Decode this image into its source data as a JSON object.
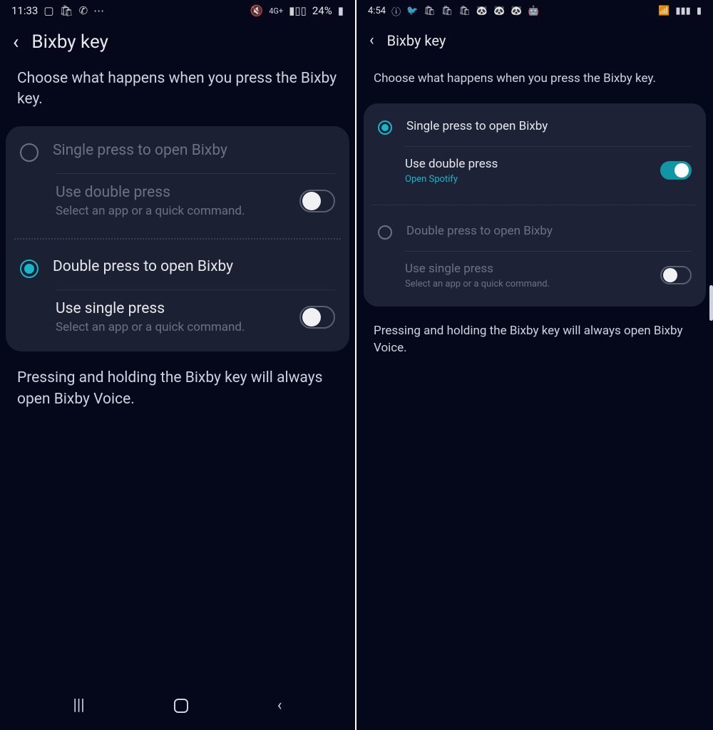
{
  "left": {
    "status": {
      "time": "11:33",
      "battery": "24%",
      "net": "4G+"
    },
    "title": "Bixby key",
    "lead": "Choose what happens when you press the Bixby key.",
    "opt1": {
      "label": "Single press to open Bixby",
      "selected": false
    },
    "sub1": {
      "label": "Use double press",
      "desc": "Select an app or a quick command.",
      "on": false,
      "enabled": false
    },
    "opt2": {
      "label": "Double press to open Bixby",
      "selected": true
    },
    "sub2": {
      "label": "Use single press",
      "desc": "Select an app or a quick command.",
      "on": false,
      "enabled": true
    },
    "foot": "Pressing and holding the Bixby key will always open Bixby Voice."
  },
  "right": {
    "status": {
      "time": "4:54"
    },
    "title": "Bixby key",
    "lead": "Choose what happens when you press the Bixby key.",
    "opt1": {
      "label": "Single press to open Bixby",
      "selected": true
    },
    "sub1": {
      "label": "Use double press",
      "desc": "Open Spotify",
      "on": true,
      "enabled": true
    },
    "opt2": {
      "label": "Double press to open Bixby",
      "selected": false
    },
    "sub2": {
      "label": "Use single press",
      "desc": "Select an app or a quick command.",
      "on": false,
      "enabled": false
    },
    "foot": "Pressing and holding the Bixby key will always open Bixby Voice."
  }
}
